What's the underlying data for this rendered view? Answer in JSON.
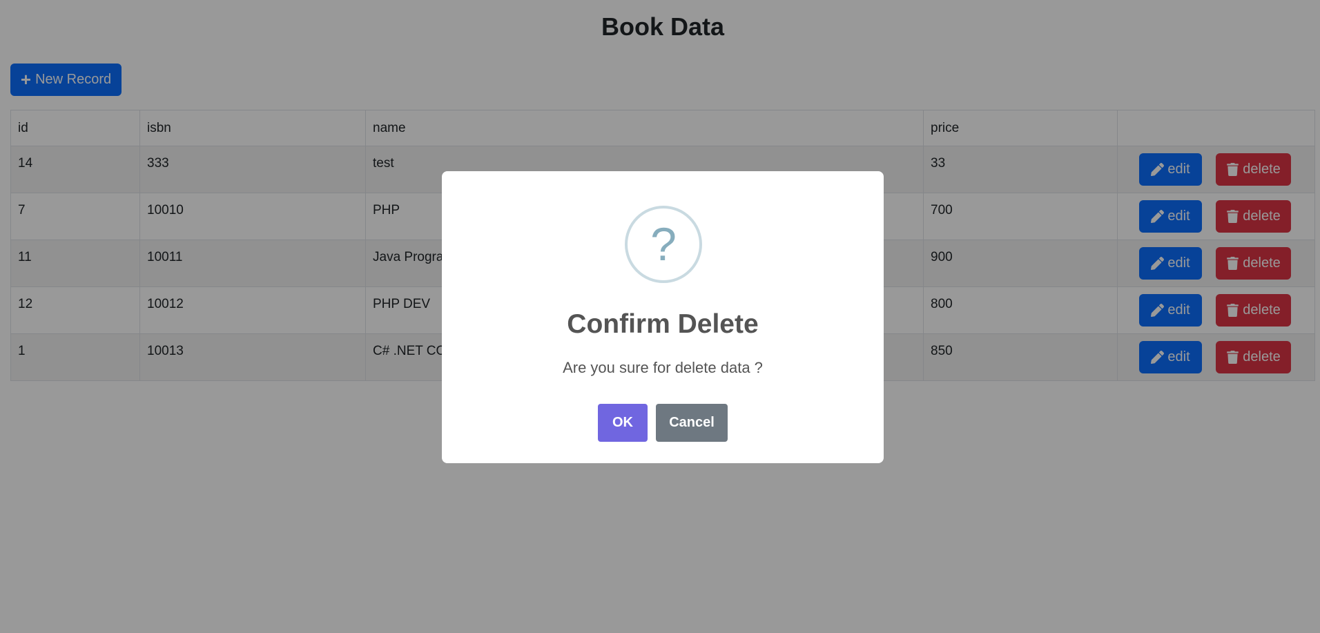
{
  "page": {
    "title": "Book Data",
    "new_record_label": "New Record"
  },
  "table": {
    "headers": [
      "id",
      "isbn",
      "name",
      "price",
      ""
    ],
    "rows": [
      {
        "id": "14",
        "isbn": "333",
        "name": "test",
        "price": "33"
      },
      {
        "id": "7",
        "isbn": "10010",
        "name": "PHP",
        "price": "700"
      },
      {
        "id": "11",
        "isbn": "10011",
        "name": "Java Programming",
        "price": "900"
      },
      {
        "id": "12",
        "isbn": "10012",
        "name": "PHP DEV",
        "price": "800"
      },
      {
        "id": "1",
        "isbn": "10013",
        "name": "C# .NET CORE",
        "price": "850"
      }
    ],
    "edit_label": "edit",
    "delete_label": "delete"
  },
  "dialog": {
    "icon": "?",
    "title": "Confirm Delete",
    "text": "Are you sure for delete data ?",
    "ok_label": "OK",
    "cancel_label": "Cancel"
  },
  "colors": {
    "primary": "#0d6efd",
    "danger": "#dc3545",
    "confirm": "#7066e0",
    "cancel": "#6e7881"
  }
}
